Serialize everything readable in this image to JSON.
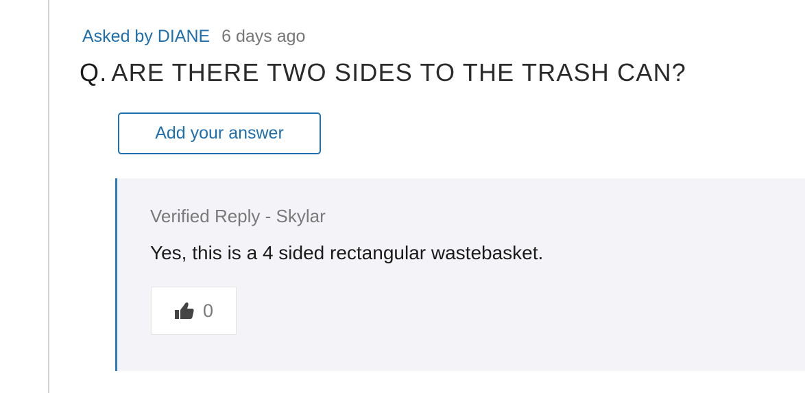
{
  "question": {
    "asked_by": "Asked by DIANE",
    "asked_ago": "6 days ago",
    "prefix": "Q.",
    "text": "ARE THERE TWO SIDES TO THE TRASH CAN?"
  },
  "actions": {
    "add_answer_label": "Add your answer"
  },
  "reply": {
    "author": "Verified Reply - Skylar",
    "text": "Yes, this is a 4 sided rectangular wastebasket.",
    "helpful_icon": "thumbs-up-icon",
    "helpful_count": "0"
  },
  "colors": {
    "link_blue": "#1f6fae",
    "reply_border": "#2d7cc0",
    "reply_bg": "#f4f4f8",
    "muted_text": "#777777"
  }
}
